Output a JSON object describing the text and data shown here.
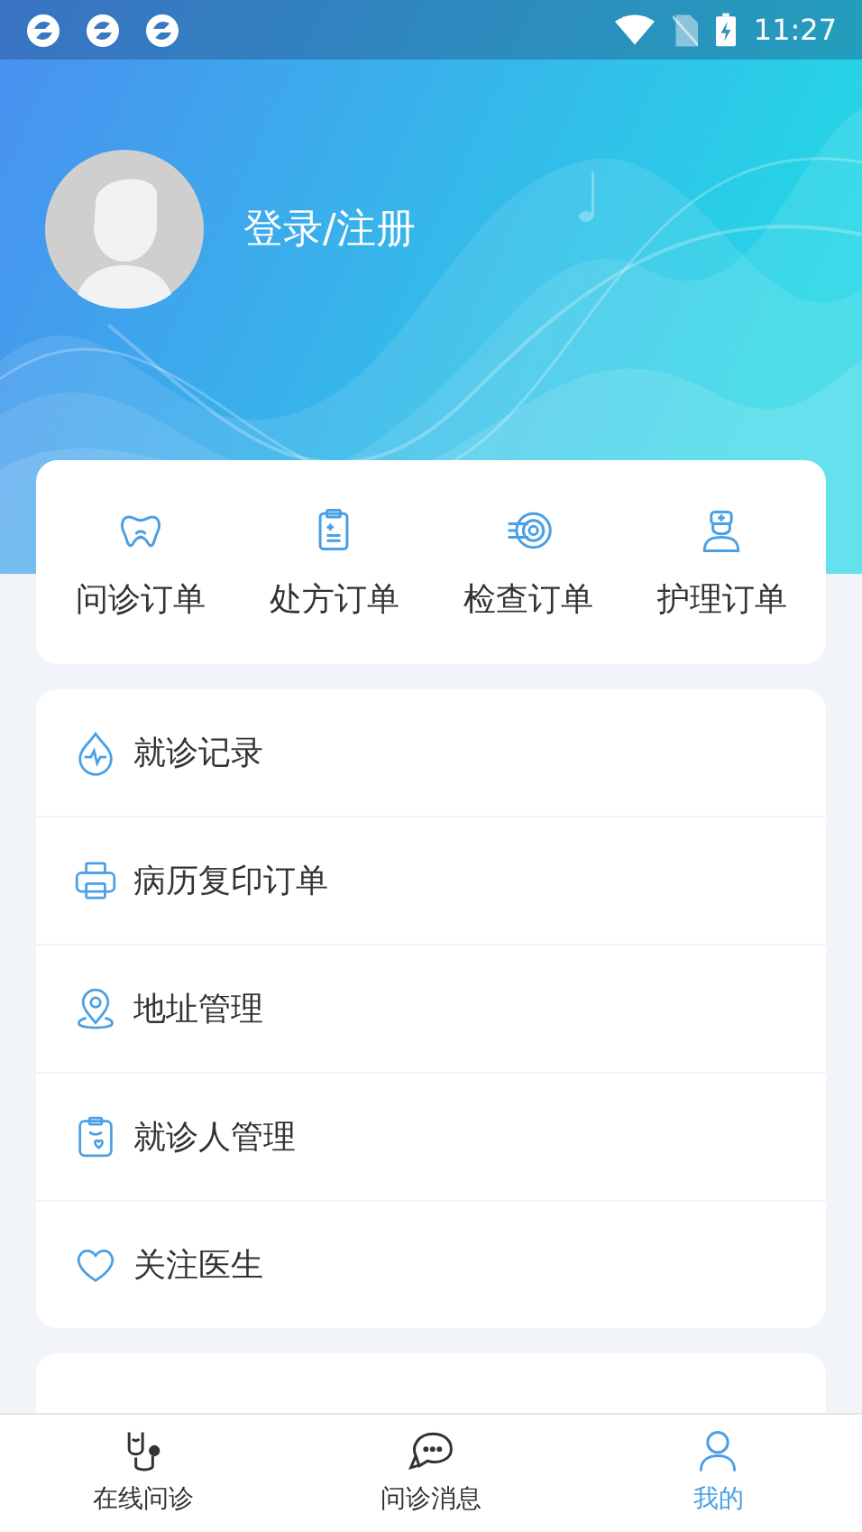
{
  "status_bar": {
    "time": "11:27"
  },
  "profile": {
    "login_label": "登录/注册"
  },
  "order_shortcuts": [
    {
      "label": "问诊订单",
      "kind": "tooth"
    },
    {
      "label": "处方订单",
      "kind": "clipboard"
    },
    {
      "label": "检查订单",
      "kind": "scan"
    },
    {
      "label": "护理订单",
      "kind": "nurse"
    }
  ],
  "menu": [
    {
      "label": "就诊记录",
      "kind": "drop"
    },
    {
      "label": "病历复印订单",
      "kind": "printer"
    },
    {
      "label": "地址管理",
      "kind": "pin"
    },
    {
      "label": "就诊人管理",
      "kind": "patient"
    },
    {
      "label": "关注医生",
      "kind": "heart"
    }
  ],
  "tab_bar": [
    {
      "label": "在线问诊",
      "kind": "stethoscope",
      "selected": false
    },
    {
      "label": "问诊消息",
      "kind": "chat",
      "selected": false
    },
    {
      "label": "我的",
      "kind": "person",
      "selected": true
    }
  ]
}
